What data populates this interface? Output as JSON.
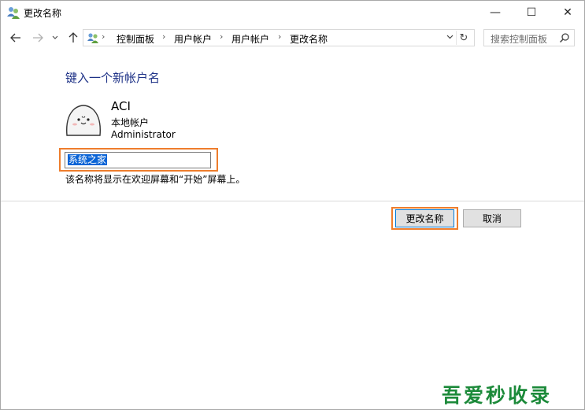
{
  "window": {
    "title": "更改名称",
    "controls": {
      "minimize": "—",
      "maximize": "☐",
      "close": "✕"
    }
  },
  "nav": {
    "back_icon": "arrow-left-icon",
    "forward_icon": "arrow-right-icon",
    "recent_icon": "chevron-down-icon",
    "up_icon": "arrow-up-icon",
    "breadcrumbs": [
      "控制面板",
      "用户帐户",
      "用户帐户",
      "更改名称"
    ],
    "search_placeholder": "搜索控制面板"
  },
  "content": {
    "heading": "键入一个新帐户名",
    "account": {
      "name": "ACI",
      "type": "本地帐户",
      "group": "Administrator"
    },
    "new_name_value": "系统之家",
    "hint": "该名称将显示在欢迎屏幕和“开始”屏幕上。"
  },
  "buttons": {
    "rename": "更改名称",
    "cancel": "取消"
  },
  "watermark": "吾爱秒收录",
  "colors": {
    "heading": "#1e3287",
    "highlight": "#ee7d2c",
    "selection": "#0a64d6",
    "watermark": "#1c8a3a"
  }
}
